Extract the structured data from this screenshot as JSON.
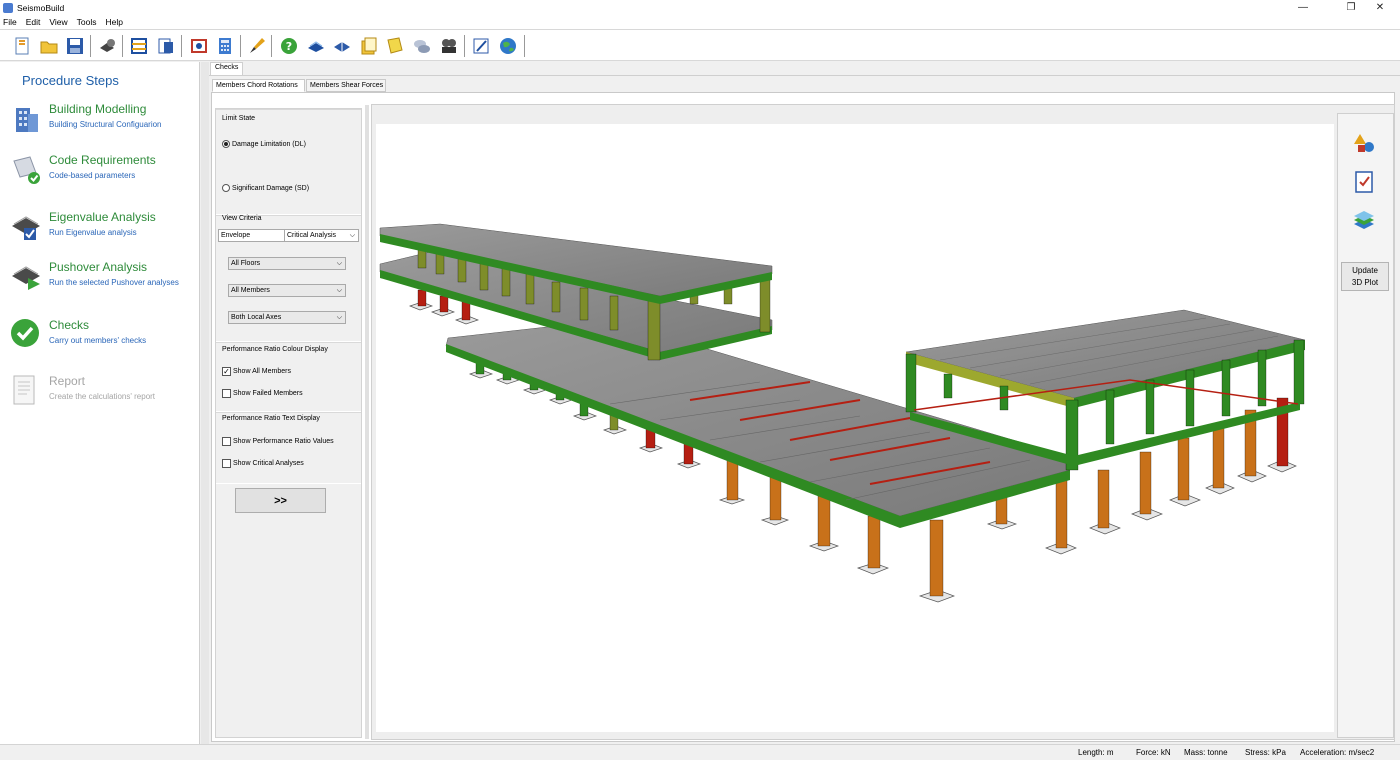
{
  "window": {
    "title": "SeismoBuild",
    "minimize": "—",
    "maximize": "❐",
    "close": "✕"
  },
  "menu": [
    "File",
    "Edit",
    "View",
    "Tools",
    "Help"
  ],
  "toolbar_icons": [
    "new-file-icon",
    "open-folder-icon",
    "save-icon",
    "settings-gear-icon",
    "structure-grid-icon",
    "report-icon",
    "model-check-icon",
    "calculator-icon",
    "brush-icon",
    "help-icon",
    "book-icon",
    "book-open-icon",
    "notes-icon",
    "documents-icon",
    "chat-icon",
    "movie-icon",
    "edit-icon",
    "globe-icon"
  ],
  "procedure": {
    "title": "Procedure Steps",
    "steps": [
      {
        "title": "Building Modelling",
        "desc": "Building Structural Configuarion",
        "icon": "building-icon",
        "enabled": true
      },
      {
        "title": "Code Requirements",
        "desc": "Code-based parameters",
        "icon": "code-check-icon",
        "enabled": true
      },
      {
        "title": "Eigenvalue Analysis",
        "desc": "Run Eigenvalue analysis",
        "icon": "eigenvalue-icon",
        "enabled": true
      },
      {
        "title": "Pushover Analysis",
        "desc": "Run the selected Pushover analyses",
        "icon": "pushover-icon",
        "enabled": true
      },
      {
        "title": "Checks",
        "desc": "Carry out members' checks",
        "icon": "checkmark-icon",
        "enabled": true
      },
      {
        "title": "Report",
        "desc": "Create the calculations' report",
        "icon": "report-doc-icon",
        "enabled": false
      }
    ]
  },
  "tabs": {
    "checks": "Checks",
    "chord": "Members Chord Rotations",
    "shear": "Members Shear Forces"
  },
  "controls": {
    "limit_state_label": "Limit State",
    "dl_label": "Damage Limitation (DL)",
    "sd_label": "Significant Damage (SD)",
    "view_criteria_label": "View Criteria",
    "envelope": "Envelope",
    "critical": "Critical Analysis",
    "floors": "All Floors",
    "members": "All Members",
    "axes": "Both Local Axes",
    "colour_label": "Performance Ratio Colour Display",
    "show_all": "Show All Members",
    "show_failed": "Show Failed Members",
    "text_label": "Performance Ratio Text Display",
    "show_values": "Show Performance Ratio Values",
    "show_critical": "Show Critical Analyses",
    "go": ">>"
  },
  "right_tools": {
    "update": "Update\n3D Plot"
  },
  "colors": {
    "green": "#2f8a22",
    "olive": "#7e8d2a",
    "red": "#b51f12",
    "orange": "#c8711a",
    "slab": "#8e8e8e"
  },
  "status": {
    "length": "Length: m",
    "force": "Force: kN",
    "mass": "Mass: tonne",
    "stress": "Stress: kPa",
    "accel": "Acceleration: m/sec2"
  }
}
